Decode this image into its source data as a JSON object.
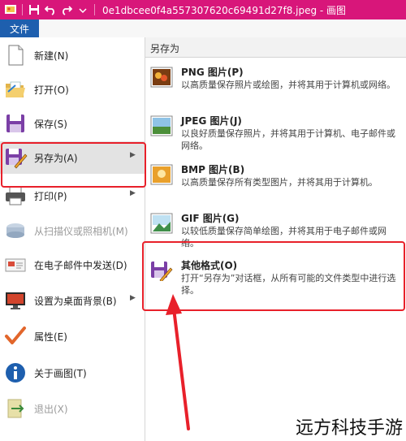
{
  "window": {
    "title": "0e1dbcee0f4a557307620c69491d27f8.jpeg - 画图",
    "file_tab": "文件"
  },
  "colors": {
    "titlebar": "#d8167a",
    "file_tab": "#1e5fae",
    "highlight_box": "#e8202a"
  },
  "menu": {
    "items": [
      {
        "label": "新建(N)",
        "icon": "new-file-icon"
      },
      {
        "label": "打开(O)",
        "icon": "open-folder-icon"
      },
      {
        "label": "保存(S)",
        "icon": "save-disk-icon"
      },
      {
        "label": "另存为(A)",
        "icon": "save-as-icon"
      },
      {
        "label": "打印(P)",
        "icon": "printer-icon"
      },
      {
        "label": "从扫描仪或照相机(M)",
        "icon": "scanner-icon"
      },
      {
        "label": "在电子邮件中发送(D)",
        "icon": "email-icon"
      },
      {
        "label": "设置为桌面背景(B)",
        "icon": "desktop-background-icon"
      },
      {
        "label": "属性(E)",
        "icon": "checkmark-icon"
      },
      {
        "label": "关于画图(T)",
        "icon": "info-icon"
      },
      {
        "label": "退出(X)",
        "icon": "exit-icon"
      }
    ]
  },
  "submenu": {
    "header": "另存为",
    "items": [
      {
        "title": "PNG 图片(P)",
        "desc": "以高质量保存照片或绘图，并将其用于计算机或网络。",
        "icon": "png-image-icon"
      },
      {
        "title": "JPEG 图片(J)",
        "desc": "以良好质量保存照片，并将其用于计算机、电子邮件或网络。",
        "icon": "jpeg-image-icon"
      },
      {
        "title": "BMP 图片(B)",
        "desc": "以高质量保存所有类型图片，并将其用于计算机。",
        "icon": "bmp-image-icon"
      },
      {
        "title": "GIF 图片(G)",
        "desc": "以较低质量保存简单绘图，并将其用于电子邮件或网络。",
        "icon": "gif-image-icon"
      },
      {
        "title": "其他格式(O)",
        "desc": "打开“另存为”对话框，从所有可能的文件类型中进行选择。",
        "icon": "other-formats-icon"
      }
    ]
  },
  "watermark": "远方科技手游"
}
